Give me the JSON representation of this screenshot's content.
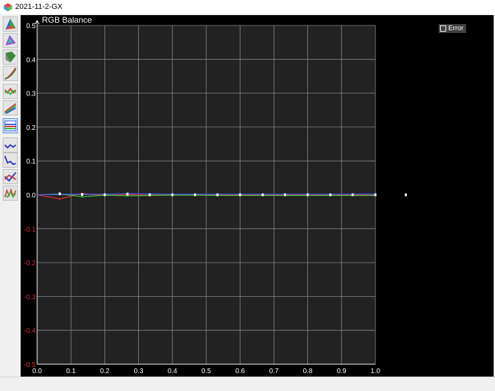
{
  "window": {
    "title": "2021-11-2-GX"
  },
  "toolbar": {
    "icons": [
      "cie-xy-gamut-icon",
      "cie-uv-gamut-icon",
      "gamut-3d-icon",
      "gamma-curve-icon",
      "rgb-curves-icon",
      "rgb-levels-icon",
      "rgb-balance-icon",
      "delta-e-icon",
      "luminance-icon",
      "saturation-icon",
      "multi-series-icon"
    ],
    "active_index": 6
  },
  "legend": {
    "error_label": "Error"
  },
  "chart_data": {
    "type": "line",
    "title": "RGB Balance",
    "xlabel": "",
    "ylabel": "",
    "xlim": [
      0.0,
      1.0
    ],
    "ylim": [
      -0.5,
      0.5
    ],
    "grid": true,
    "x_ticks": [
      "0.0",
      "0.1",
      "0.2",
      "0.3",
      "0.4",
      "0.5",
      "0.6",
      "0.7",
      "0.8",
      "0.9",
      "1.0"
    ],
    "y_ticks": [
      "0.5",
      "0.4",
      "0.3",
      "0.2",
      "0.1",
      "0.0",
      "-0.1",
      "-0.2",
      "-0.3",
      "-0.4",
      "-0.5"
    ],
    "x": [
      0.0,
      0.067,
      0.133,
      0.2,
      0.267,
      0.333,
      0.4,
      0.467,
      0.533,
      0.6,
      0.667,
      0.733,
      0.8,
      0.867,
      0.933,
      1.0
    ],
    "series": [
      {
        "color": "#ff3030",
        "values": [
          0.0,
          -0.012,
          0.004,
          -0.002,
          0.001,
          -0.001,
          0.0,
          0.0,
          -0.001,
          0.0,
          -0.001,
          0.0,
          0.0,
          -0.001,
          0.0,
          -0.001
        ]
      },
      {
        "color": "#30d030",
        "values": [
          0.0,
          0.003,
          -0.006,
          -0.001,
          -0.003,
          -0.002,
          -0.001,
          -0.001,
          -0.002,
          -0.002,
          -0.002,
          -0.002,
          -0.002,
          -0.002,
          -0.002,
          -0.002
        ]
      },
      {
        "color": "#3050ff",
        "values": [
          0.0,
          0.002,
          0.002,
          0.002,
          0.004,
          0.003,
          0.002,
          0.002,
          0.002,
          0.002,
          0.002,
          0.002,
          0.002,
          0.002,
          0.002,
          0.003
        ]
      }
    ],
    "markers": {
      "x": [
        0.067,
        0.133,
        0.2,
        0.267,
        0.333,
        0.4,
        0.467,
        0.533,
        0.6,
        0.667,
        0.733,
        0.8,
        0.867,
        0.933,
        1.0,
        1.09
      ],
      "values": [
        0.003,
        0.001,
        0.0,
        0.002,
        0.0,
        0.0,
        0.0,
        0.0,
        0.0,
        0.0,
        0.0,
        0.0,
        0.0,
        0.0,
        0.0,
        0.0
      ]
    },
    "colors": {
      "background": "#000000",
      "plot": "#222222",
      "grid": "#8c8c8c",
      "negative_tick": "#d03030",
      "tick": "#ffffff"
    }
  }
}
